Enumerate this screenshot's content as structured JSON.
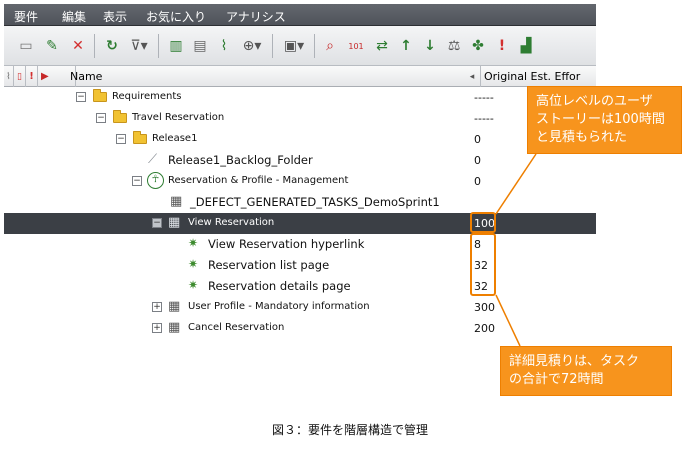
{
  "menu": [
    "要件",
    "編集",
    "表示",
    "お気に入り",
    "アナリシス"
  ],
  "toolbar_icons": [
    "new-requirement-icon",
    "new-child-icon",
    "delete-icon",
    "refresh-icon",
    "filter-icon",
    "columns-icon",
    "details-icon",
    "attachment-icon",
    "zoom-icon",
    "view-select-icon",
    "find-icon",
    "goto-id-icon",
    "convert-icon",
    "move-up-icon",
    "move-down-icon",
    "risk-icon",
    "coverage-icon",
    "alert-icon",
    "analysis-icon"
  ],
  "toolbar_labels": {
    "goto_id": "101"
  },
  "header": {
    "name": "Name",
    "estimate": "Original Est. Effor"
  },
  "tree": [
    {
      "label": "Requirements",
      "value": "-----"
    },
    {
      "label": "Travel Reservation",
      "value": "-----"
    },
    {
      "label": "Release1",
      "value": "0"
    },
    {
      "label": "Release1_Backlog_Folder",
      "value": "0"
    },
    {
      "label": "Reservation & Profile - Management",
      "value": "0"
    },
    {
      "label": "_DEFECT_GENERATED_TASKS_DemoSprint1",
      "value": ""
    },
    {
      "label": "View Reservation",
      "value": "100"
    },
    {
      "label": "View Reservation hyperlink",
      "value": "8"
    },
    {
      "label": "Reservation list page",
      "value": "32"
    },
    {
      "label": "Reservation details page",
      "value": "32"
    },
    {
      "label": "User Profile - Mandatory information",
      "value": "300"
    },
    {
      "label": "Cancel Reservation",
      "value": "200"
    }
  ],
  "callouts": {
    "top": {
      "line1": "高位レベルのユーザ",
      "line2": "ストーリーは100時間",
      "line3": "と見積もられた"
    },
    "bottom": {
      "line1": "詳細見積りは、タスク",
      "line2": "の合計で72時間"
    }
  },
  "caption": "図３：要件を階層構造で管理",
  "colors": {
    "accent": "#f7941d",
    "selection": "#3b3f45",
    "menubar": "#595d64"
  }
}
